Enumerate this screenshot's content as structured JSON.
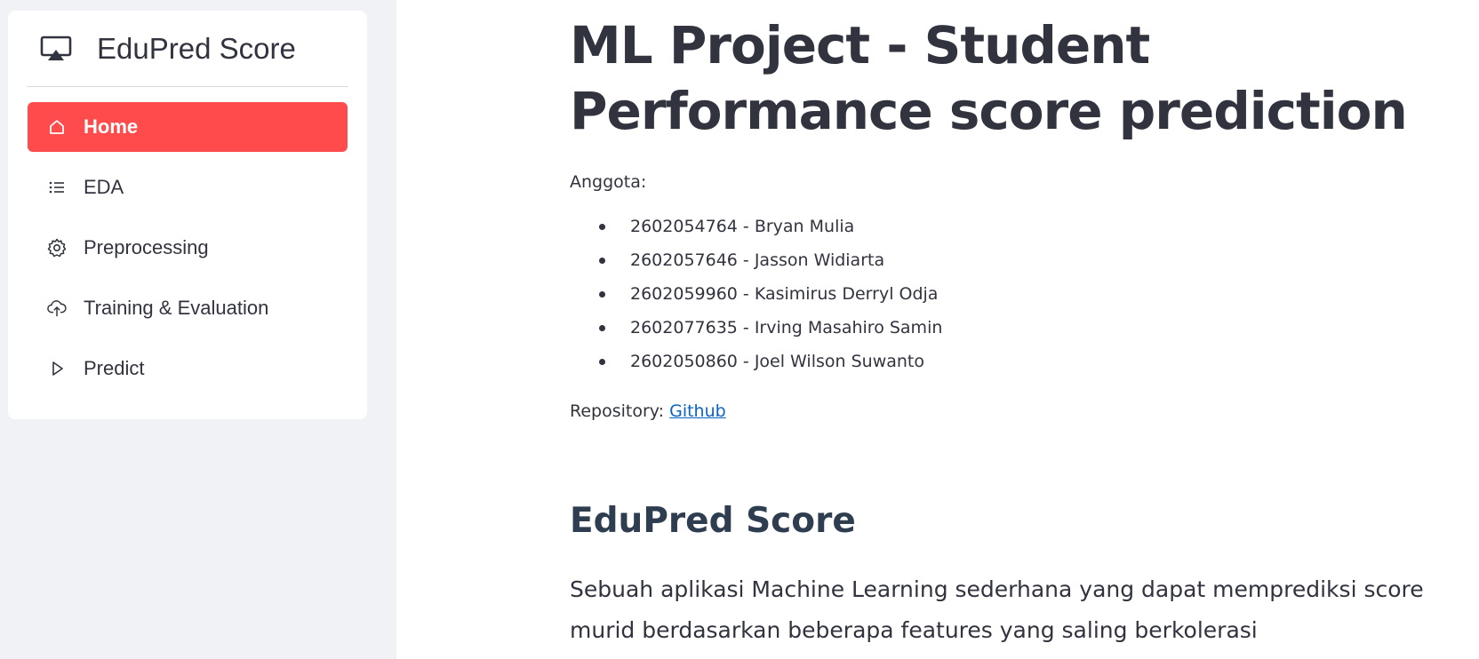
{
  "sidebar": {
    "brand": {
      "title": "EduPred Score",
      "icon": "airplay-icon"
    },
    "items": [
      {
        "label": "Home",
        "icon": "home-icon",
        "active": true
      },
      {
        "label": "EDA",
        "icon": "list-icon",
        "active": false
      },
      {
        "label": "Preprocessing",
        "icon": "gear-icon",
        "active": false
      },
      {
        "label": "Training & Evaluation",
        "icon": "cloud-upload-icon",
        "active": false
      },
      {
        "label": "Predict",
        "icon": "play-icon",
        "active": false
      }
    ]
  },
  "main": {
    "title": "ML Project - Student Performance score prediction",
    "members_label": "Anggota:",
    "members": [
      "2602054764 - Bryan Mulia",
      "2602057646 - Jasson Widiarta",
      "2602059960 - Kasimirus Derryl Odja",
      "2602077635 - Irving Masahiro Samin",
      "2602050860 - Joel Wilson Suwanto"
    ],
    "repo_label": "Repository: ",
    "repo_link": "Github",
    "section_title": "EduPred Score",
    "section_desc": "Sebuah aplikasi Machine Learning sederhana yang dapat memprediksi score murid berdasarkan beberapa features yang saling berkolerasi"
  },
  "colors": {
    "accent": "#ff4b4b",
    "sidebar_bg": "#f0f2f6",
    "text": "#31333f",
    "link": "#0b63c5"
  }
}
